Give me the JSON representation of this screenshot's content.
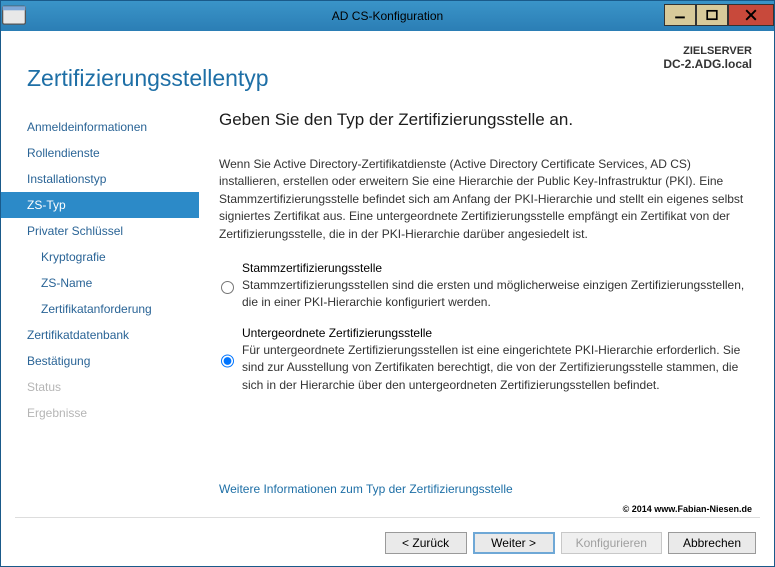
{
  "window": {
    "title": "AD CS-Konfiguration"
  },
  "header": {
    "wizard_title": "Zertifizierungsstellentyp",
    "target_label": "ZIELSERVER",
    "target_server": "DC-2.ADG.local"
  },
  "nav": {
    "items": [
      {
        "label": "Anmeldeinformationen"
      },
      {
        "label": "Rollendienste"
      },
      {
        "label": "Installationstyp"
      },
      {
        "label": "ZS-Typ"
      },
      {
        "label": "Privater Schlüssel"
      },
      {
        "label": "Kryptografie"
      },
      {
        "label": "ZS-Name"
      },
      {
        "label": "Zertifikatanforderung"
      },
      {
        "label": "Zertifikatdatenbank"
      },
      {
        "label": "Bestätigung"
      },
      {
        "label": "Status"
      },
      {
        "label": "Ergebnisse"
      }
    ]
  },
  "content": {
    "heading": "Geben Sie den Typ der Zertifizierungsstelle an.",
    "intro": "Wenn Sie Active Directory-Zertifikatdienste (Active Directory Certificate Services, AD CS) installieren, erstellen oder erweitern Sie eine Hierarchie der Public Key-Infrastruktur (PKI). Eine Stammzertifizierungsstelle befindet sich am Anfang der PKI-Hierarchie und stellt ein eigenes selbst signiertes Zertifikat aus. Eine untergeordnete Zertifizierungsstelle empfängt ein Zertifikat von der Zertifizierungsstelle, die in der PKI-Hierarchie darüber angesiedelt ist.",
    "options": [
      {
        "label": "Stammzertifizierungsstelle",
        "desc": "Stammzertifizierungsstellen sind die ersten und möglicherweise einzigen Zertifizierungsstellen, die in einer PKI-Hierarchie konfiguriert werden."
      },
      {
        "label": "Untergeordnete Zertifizierungsstelle",
        "desc": "Für untergeordnete Zertifizierungsstellen ist eine eingerichtete PKI-Hierarchie erforderlich. Sie sind zur Ausstellung von Zertifikaten berechtigt, die von der Zertifizierungsstelle stammen, die sich in der Hierarchie über den untergeordneten Zertifizierungsstellen befindet."
      }
    ],
    "more_link": "Weitere Informationen zum Typ der Zertifizierungsstelle"
  },
  "footer": {
    "copyright": "© 2014 www.Fabian-Niesen.de",
    "buttons": {
      "back": "< Zurück",
      "next": "Weiter >",
      "configure": "Konfigurieren",
      "cancel": "Abbrechen"
    }
  }
}
